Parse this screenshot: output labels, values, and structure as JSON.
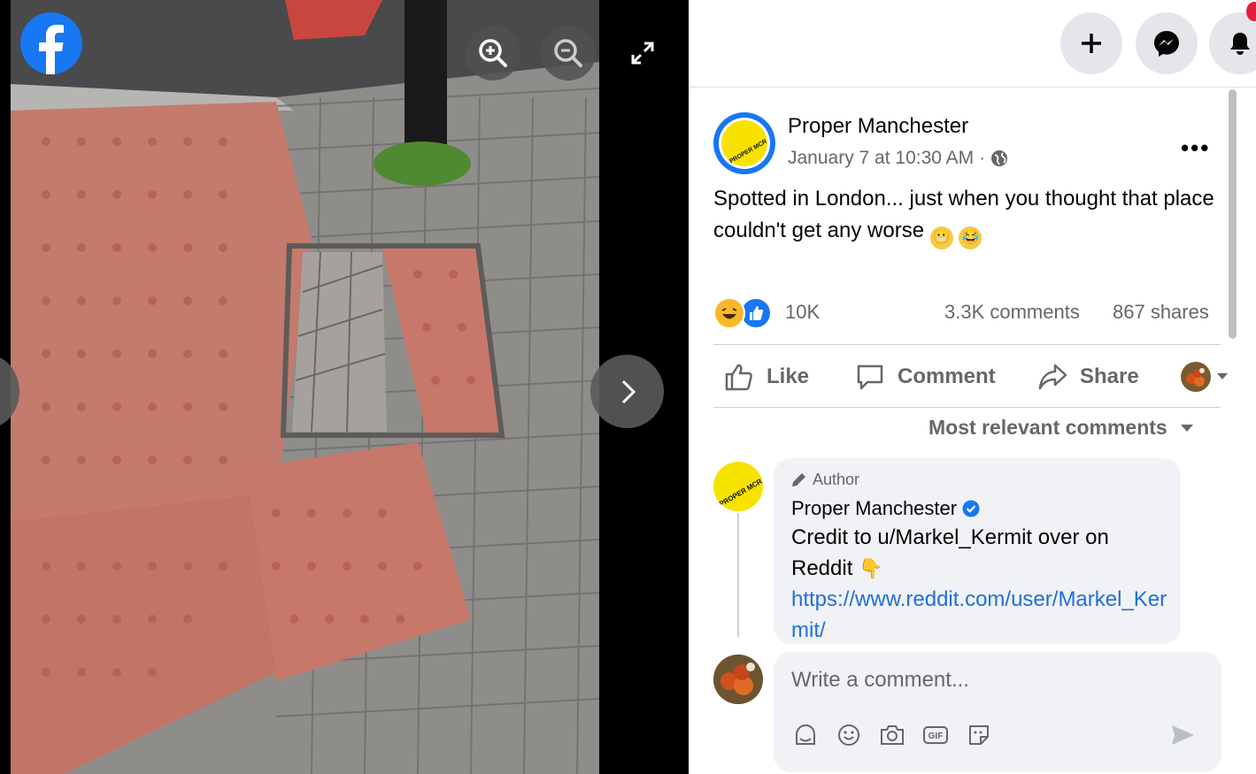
{
  "viewer": {
    "brand_icon": "facebook-logo",
    "zoom_in_icon": "zoom-in-icon",
    "zoom_out_icon": "zoom-out-icon",
    "fullscreen_icon": "expand-icon",
    "next_icon": "chevron-right-icon"
  },
  "topbar": {
    "create_icon": "plus-icon",
    "messenger_icon": "messenger-icon",
    "notifications_icon": "bell-icon"
  },
  "post": {
    "page_name": "Proper Manchester",
    "date": "January 7 at 10:30 AM",
    "separator": "·",
    "audience_icon": "globe-icon",
    "more_label": "•••",
    "text": "Spotted in London... just when you thought that place couldn't get any worse",
    "reaction_count": "10K",
    "comments": "3.3K comments",
    "shares": "867 shares",
    "reaction_icons": [
      "laugh-reaction-icon",
      "like-reaction-icon"
    ]
  },
  "actions": {
    "like": "Like",
    "comment": "Comment",
    "share": "Share"
  },
  "sort_label": "Most relevant comments",
  "comment": {
    "badge": "Author",
    "name": "Proper Manchester",
    "verified_icon": "verified-badge-icon",
    "text": "Credit to u/Markel_Kermit over on Reddit",
    "link": "https://www.reddit.com/user/Markel_Kermit/"
  },
  "composer": {
    "placeholder": "Write a comment...",
    "tools": [
      "avatar-sticker-icon",
      "emoji-icon",
      "camera-icon",
      "gif-icon",
      "sticker-icon"
    ],
    "send_icon": "send-icon"
  },
  "colors": {
    "facebook_blue": "#1877f2",
    "link": "#216fdb",
    "secondary_text": "#65676b",
    "brand_yellow": "#f7e200"
  }
}
